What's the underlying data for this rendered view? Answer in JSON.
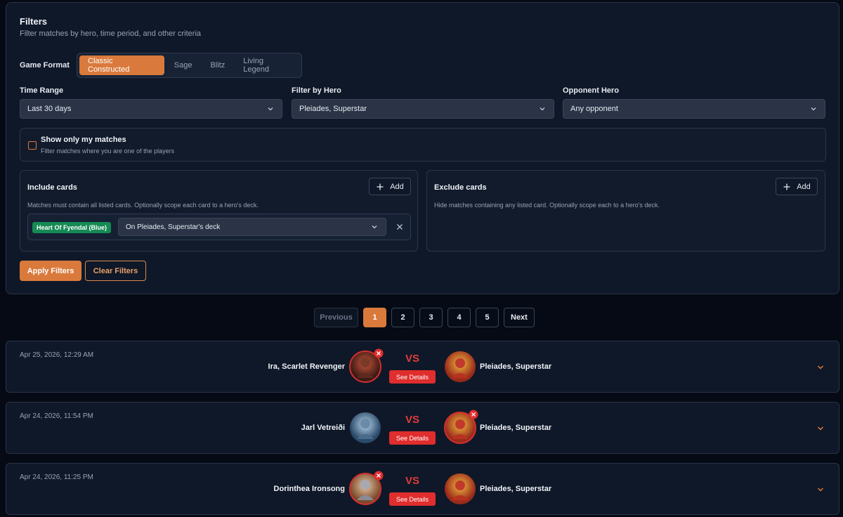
{
  "filters": {
    "title": "Filters",
    "subtitle": "Filter matches by hero, time period, and other criteria",
    "format_label": "Game Format",
    "formats": [
      "Classic Constructed",
      "Sage",
      "Blitz",
      "Living Legend"
    ],
    "active_format": "Classic Constructed",
    "time_range": {
      "label": "Time Range",
      "value": "Last 30 days"
    },
    "hero": {
      "label": "Filter by Hero",
      "value": "Pleiades, Superstar"
    },
    "opponent": {
      "label": "Opponent Hero",
      "value": "Any opponent"
    },
    "show_only": {
      "title": "Show only my matches",
      "subtitle": "Filter matches where you are one of the players",
      "checked": false
    },
    "include": {
      "title": "Include cards",
      "add_label": "Add",
      "description": "Matches must contain all listed cards. Optionally scope each card to a hero's deck.",
      "card": "Heart Of Fyendal (Blue)",
      "scope": "On Pleiades, Superstar's deck"
    },
    "exclude": {
      "title": "Exclude cards",
      "add_label": "Add",
      "description": "Hide matches containing any listed card. Optionally scope each to a hero's deck."
    },
    "apply_label": "Apply Filters",
    "clear_label": "Clear Filters"
  },
  "pagination": {
    "previous": "Previous",
    "pages": [
      "1",
      "2",
      "3",
      "4",
      "5"
    ],
    "current": "1",
    "next": "Next"
  },
  "matches": [
    {
      "date": "Apr 25, 2026, 12:29 AM",
      "player1": "Ira, Scarlet Revenger",
      "player2": "Pleiades, Superstar",
      "winner": "player1",
      "vs": "VS",
      "details_label": "See Details"
    },
    {
      "date": "Apr 24, 2026, 11:54 PM",
      "player1": "Jarl Vetreiði",
      "player2": "Pleiades, Superstar",
      "winner": "player2",
      "vs": "VS",
      "details_label": "See Details"
    },
    {
      "date": "Apr 24, 2026, 11:25 PM",
      "player1": "Dorinthea Ironsong",
      "player2": "Pleiades, Superstar",
      "winner": "player1",
      "vs": "VS",
      "details_label": "See Details"
    }
  ],
  "colors": {
    "accent": "#d97a3c",
    "card_badge": "#158a54",
    "vs": "#e23b3b",
    "details": "#e02d2d"
  }
}
